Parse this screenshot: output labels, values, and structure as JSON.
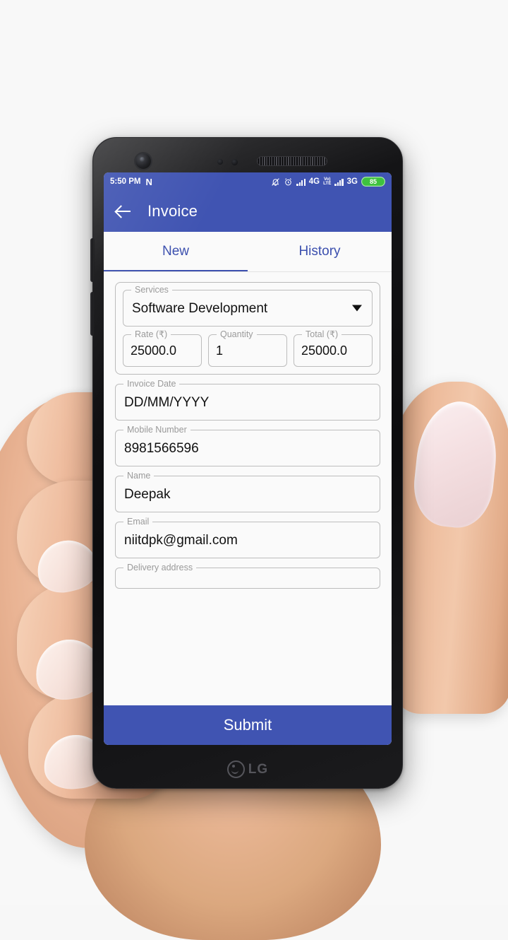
{
  "status_bar": {
    "time": "5:50 PM",
    "nfc_label": "N",
    "mute_icon": "bell-muted-icon",
    "alarm_icon": "alarm-clock-icon",
    "sim1_network": "4G",
    "volte_line1": "Vo)",
    "volte_line2": "LTE",
    "sim2_network": "3G",
    "battery_percent": "85"
  },
  "app_bar": {
    "back_label": "back-arrow",
    "title": "Invoice"
  },
  "tabs": [
    {
      "label": "New",
      "active": true
    },
    {
      "label": "History",
      "active": false
    }
  ],
  "form": {
    "services": {
      "label": "Services",
      "value": "Software Development"
    },
    "rate": {
      "label": "Rate (₹)",
      "value": "25000.0"
    },
    "quantity": {
      "label": "Quantity",
      "value": "1"
    },
    "total": {
      "label": "Total (₹)",
      "value": "25000.0"
    },
    "invoice_date": {
      "label": "Invoice Date",
      "value": "DD/MM/YYYY"
    },
    "mobile_number": {
      "label": "Mobile Number",
      "value": "8981566596"
    },
    "name": {
      "label": "Name",
      "value": "Deepak"
    },
    "email": {
      "label": "Email",
      "value": "niitdpk@gmail.com"
    },
    "delivery_address": {
      "label": "Delivery address",
      "value": ""
    }
  },
  "submit_button": {
    "label": "Submit"
  },
  "device": {
    "brand": "LG"
  },
  "colors": {
    "primary": "#4054b2",
    "tab_text": "#3b4fae",
    "battery": "#3ec23e",
    "field_border": "#bdbdbd",
    "label_text": "#9a9a9a",
    "page_background": "#f7f7f7"
  }
}
